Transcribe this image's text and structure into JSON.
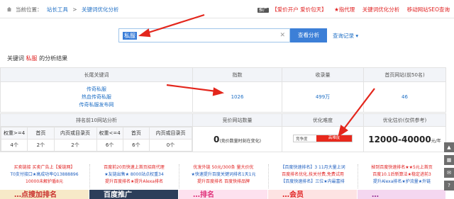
{
  "breadcrumb": {
    "label": "当前位置：",
    "level1": "站长工具",
    "sep": ">",
    "level2": "关键词优化分析",
    "promo_tag": "推广",
    "promo": "【爱价开户 爱价包天】",
    "link1": "★指代理",
    "link2": "关键词优化分析",
    "link3": "移动网站SEO查询"
  },
  "search": {
    "value": "私服",
    "button": "查看分析",
    "history": "查询记录",
    "clear_icon": "close-icon"
  },
  "result_title": {
    "prefix": "关键词",
    "keyword": "私服",
    "suffix": "的分析结果"
  },
  "top_table": {
    "headers": [
      "长尾关键词",
      "指数",
      "收录量",
      "首页网站(前50名)"
    ],
    "long_tail": [
      "传奇私服",
      "热血传奇私服",
      "传奇私服发布网"
    ],
    "index": "1026",
    "indexed": "499万",
    "home_sites": "46"
  },
  "bottom_table": {
    "headers": [
      "排名前10网站分析",
      "竞价网站数量",
      "优化难度",
      "优化估价(仅供参考)"
    ],
    "sub_headers": [
      "权重>=4",
      "首页",
      "内页或目录页",
      "权重<=4",
      "首页",
      "内页或目录页"
    ],
    "sub_values": [
      "4个",
      "2个",
      "2个",
      "6个",
      "6个",
      "0个"
    ],
    "bid_count": "0",
    "bid_note": "(竞价数量时刻在变化)",
    "difficulty_label": "竞争度",
    "difficulty_value": "高难度",
    "price": "12000-40000",
    "price_unit": "元/年"
  },
  "ads": [
    [
      "买卖链接 买卖广告上【爱链网】",
      "T0支付接口★高成功率Q13888896",
      "10000未解护盾8元"
    ],
    [
      "百度前20页快速上首页招商代理",
      "★友链出售★ 8000站点权重34",
      "提升百度排名★提升Alexa排名"
    ],
    [
      "优发外链 50元/300条 量大价优",
      "★快速提升百度关键词排名1天1元",
      "提升百度排名 百度快排品牌"
    ],
    [
      "【百度快速排名】3 11月大量上词",
      "百度排名优化,技关付费,免费试用",
      "【百度快速排名】三位★内最富排"
    ],
    [
      "掉到百度快速排名★★5元上首页",
      "百度10.1后新算法★稳定进前3",
      "提升Alexa排名★护流量★外链"
    ]
  ],
  "banners": [
    "…点搜加排名",
    "百度推广",
    "…排名",
    "…会员",
    "…"
  ],
  "side_icons": [
    "arrow-up-icon",
    "qr-code-icon",
    "chat-icon",
    "help-icon"
  ],
  "colors": {
    "accent": "#3c7fd7",
    "arrow": "#e3261c",
    "difficulty": "#e8281c"
  }
}
